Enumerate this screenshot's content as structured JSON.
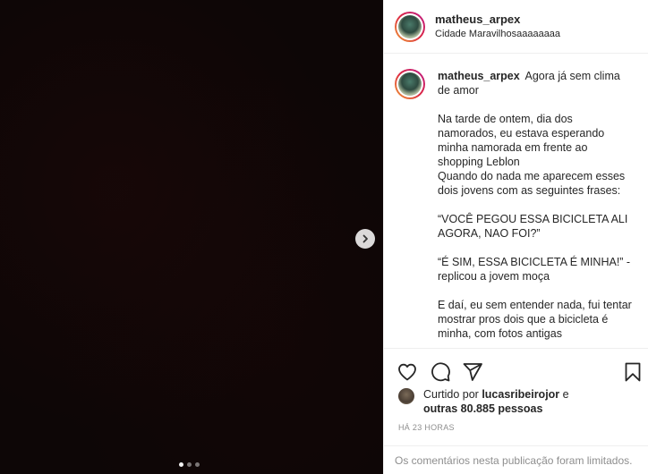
{
  "post": {
    "author": "matheus_arpex",
    "location": "Cidade Maravilhosaaaaaaaa",
    "caption_first_line": "Agora já sem clima de amor",
    "caption_body": "Na tarde de ontem, dia dos namorados, eu estava esperando minha namorada em frente ao shopping Leblon\nQuando do nada me aparecem esses dois jovens com as seguintes frases:\n\n“VOCÊ PEGOU ESSA BICICLETA ALI AGORA, NAO FOI?”\n\n“É SIM, ESSA BICICLETA É MINHA!” - replicou a jovem moça\n\nE daí, eu sem entender nada, fui tentar mostrar pros dois que a bicicleta é minha, com fotos antigas"
  },
  "likes": {
    "prefix": "Curtido por",
    "user": "lucasribeirojor",
    "conjunction": "e",
    "others": "outras 80.885 pessoas"
  },
  "timestamp": "Há 23 horas",
  "comments_limited": "Os comentários nesta publicação foram limitados.",
  "carousel": {
    "slide_count": 3,
    "active_index": 0
  },
  "icons": {
    "next": "chevron-right-icon",
    "like": "heart-icon",
    "comment": "comment-icon",
    "share": "send-icon",
    "save": "bookmark-icon"
  }
}
